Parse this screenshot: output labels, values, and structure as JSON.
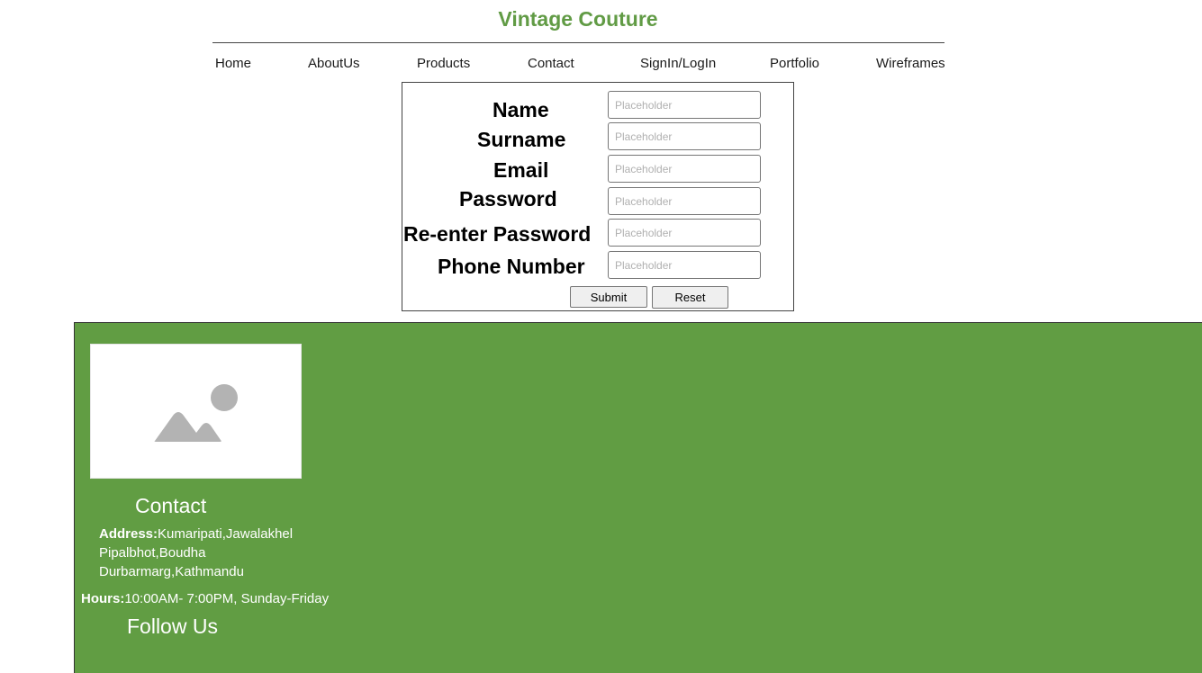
{
  "site": {
    "title": "Vintage Couture"
  },
  "nav": {
    "items": [
      {
        "label": "Home"
      },
      {
        "label": "AboutUs"
      },
      {
        "label": "Products"
      },
      {
        "label": "Contact"
      },
      {
        "label": "SignIn/LogIn"
      },
      {
        "label": "Portfolio"
      },
      {
        "label": "Wireframes"
      }
    ]
  },
  "form": {
    "fields": [
      {
        "label": "Name",
        "placeholder": "Placeholder",
        "value": ""
      },
      {
        "label": "Surname",
        "placeholder": "Placeholder",
        "value": ""
      },
      {
        "label": "Email",
        "placeholder": "Placeholder",
        "value": ""
      },
      {
        "label": "Password",
        "placeholder": "Placeholder",
        "value": ""
      },
      {
        "label": "Re-enter Password",
        "placeholder": "Placeholder",
        "value": ""
      },
      {
        "label": "Phone Number",
        "placeholder": "Placeholder",
        "value": ""
      }
    ],
    "submit_label": "Submit",
    "reset_label": "Reset"
  },
  "footer": {
    "image_icon": "image-placeholder-icon",
    "contact_heading": "Contact",
    "address_label": "Address:",
    "address_line1": "Kumaripati,Jawalakhel",
    "address_line2": "Pipalbhot,Boudha",
    "address_line3": "Durbarmarg,Kathmandu",
    "hours_label": "Hours:",
    "hours_value": "10:00AM- 7:00PM, Sunday-Friday",
    "follow_heading": "Follow Us"
  },
  "colors": {
    "brand_green": "#619b45",
    "footer_green": "#619d43"
  }
}
